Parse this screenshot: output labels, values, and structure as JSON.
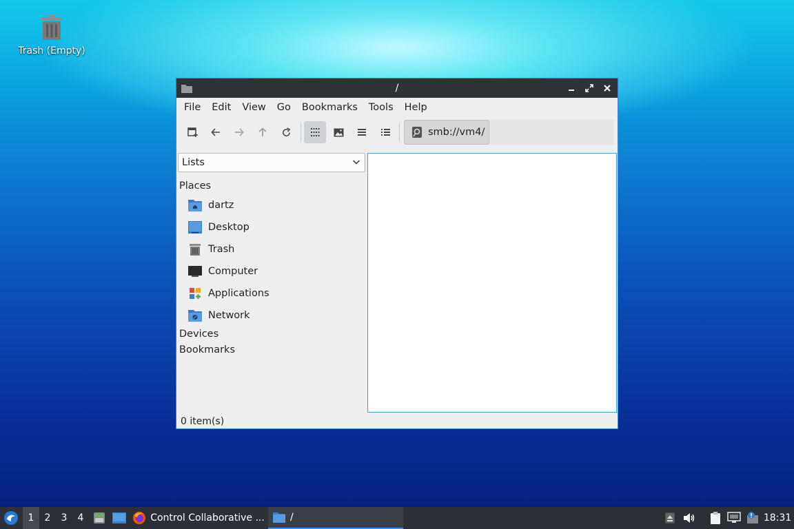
{
  "desktop": {
    "trash_label": "Trash (Empty)"
  },
  "window": {
    "title": "/",
    "menu": [
      "File",
      "Edit",
      "View",
      "Go",
      "Bookmarks",
      "Tools",
      "Help"
    ],
    "path": "smb://vm4/",
    "side_panel": {
      "mode": "Lists",
      "sections": {
        "places": "Places",
        "devices": "Devices",
        "bookmarks": "Bookmarks"
      },
      "places": [
        "dartz",
        "Desktop",
        "Trash",
        "Computer",
        "Applications",
        "Network"
      ]
    },
    "status": "0 item(s)"
  },
  "taskbar": {
    "workspaces": [
      "1",
      "2",
      "3",
      "4"
    ],
    "tasks": [
      "Control Collaborative ...",
      "/"
    ],
    "clock": "18:31"
  },
  "colors": {
    "accent": "#3a8ee6",
    "titlebar": "#2f3338",
    "taskbar": "#2c3036"
  }
}
